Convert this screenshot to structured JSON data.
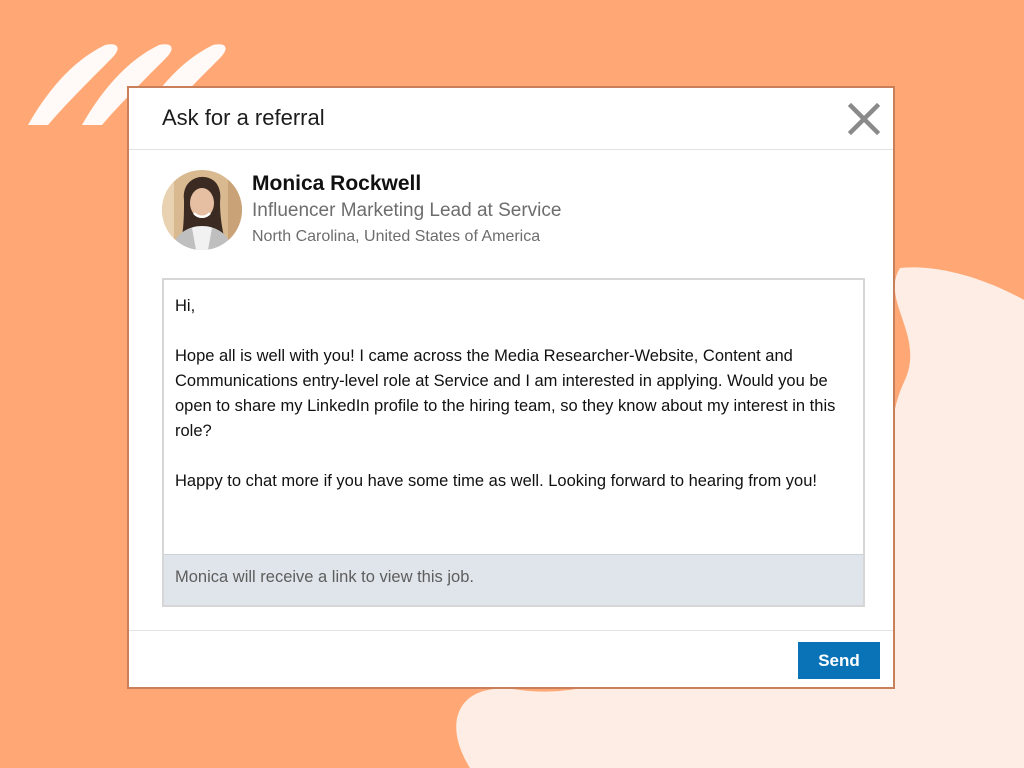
{
  "colors": {
    "background": "#FFA875",
    "accent_blob": "#FDEDE4",
    "send_button": "#0A73B8",
    "footer_bar": "#DFE5EA"
  },
  "modal": {
    "title": "Ask for a referral",
    "close_icon": "close-icon"
  },
  "profile": {
    "name": "Monica Rockwell",
    "headline": "Influencer Marketing Lead at Service",
    "location": "North Carolina, United States of America"
  },
  "message": {
    "greeting": "Hi,",
    "paragraph1": "Hope all is well with you! I came across the Media Researcher-Website, Content and Communications entry-level role at Service and I am interested in applying. Would you be open to share my LinkedIn profile to the hiring team, so they know about my interest in this role?",
    "paragraph2": "Happy to chat more if you have some time as well. Looking forward to hearing from you!",
    "notice": "Monica will receive a link to view this job."
  },
  "actions": {
    "send_label": "Send"
  }
}
